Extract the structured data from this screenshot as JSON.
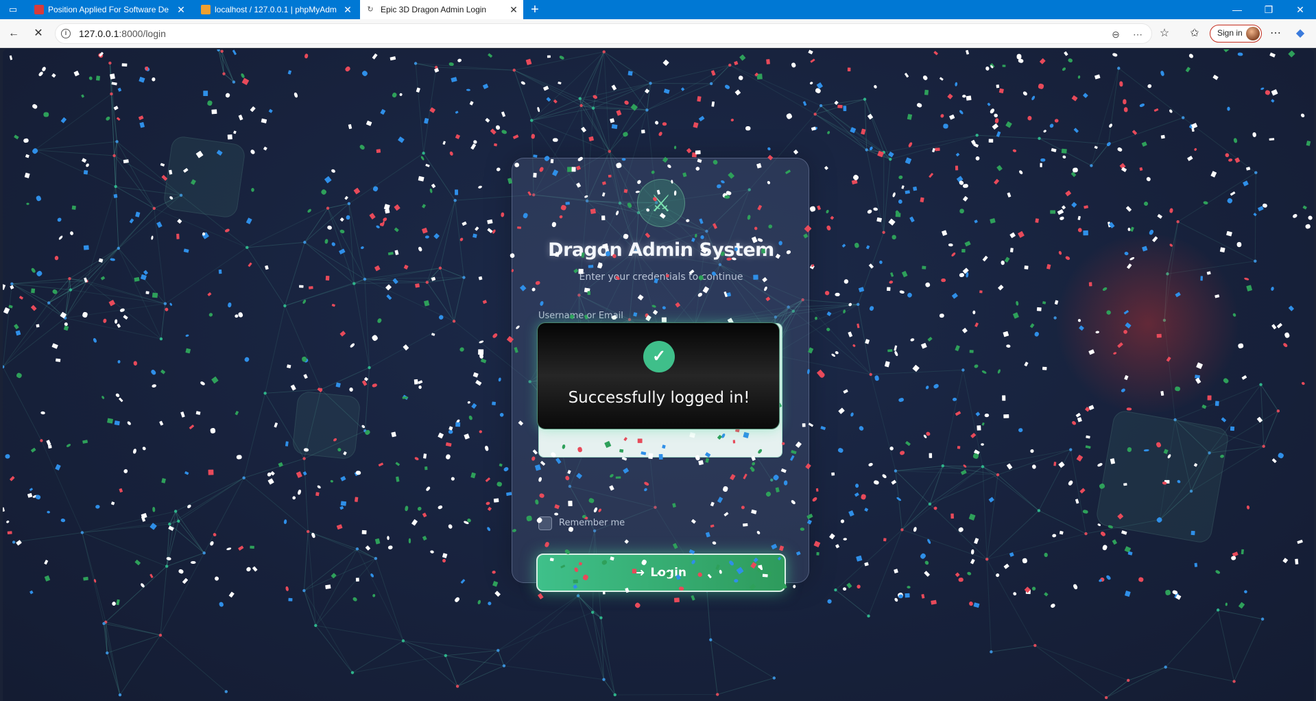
{
  "browser": {
    "tabs": [
      {
        "title": "Position Applied For Software De",
        "favicon": "pdf-icon",
        "color": "#d83b3b"
      },
      {
        "title": "localhost / 127.0.0.1 | phpMyAdm",
        "favicon": "phpmyadmin-icon",
        "color": "#f0a030"
      },
      {
        "title": "Epic 3D Dragon Admin Login",
        "favicon": "loading-icon",
        "color": "#ffffff"
      }
    ],
    "url_host": "127.0.0.1",
    "url_path": ":8000/login",
    "signin_label": "Sign in",
    "accent": "#0078d4"
  },
  "login": {
    "title": "Dragon Admin System",
    "subtitle": "Enter your credentials to continue",
    "username_label": "Username or Email",
    "remember_label": "Remember me",
    "login_button": "Login",
    "accent": "#3fc08a"
  },
  "toast": {
    "message": "Successfully logged in!",
    "icon": "check-circle-icon"
  }
}
